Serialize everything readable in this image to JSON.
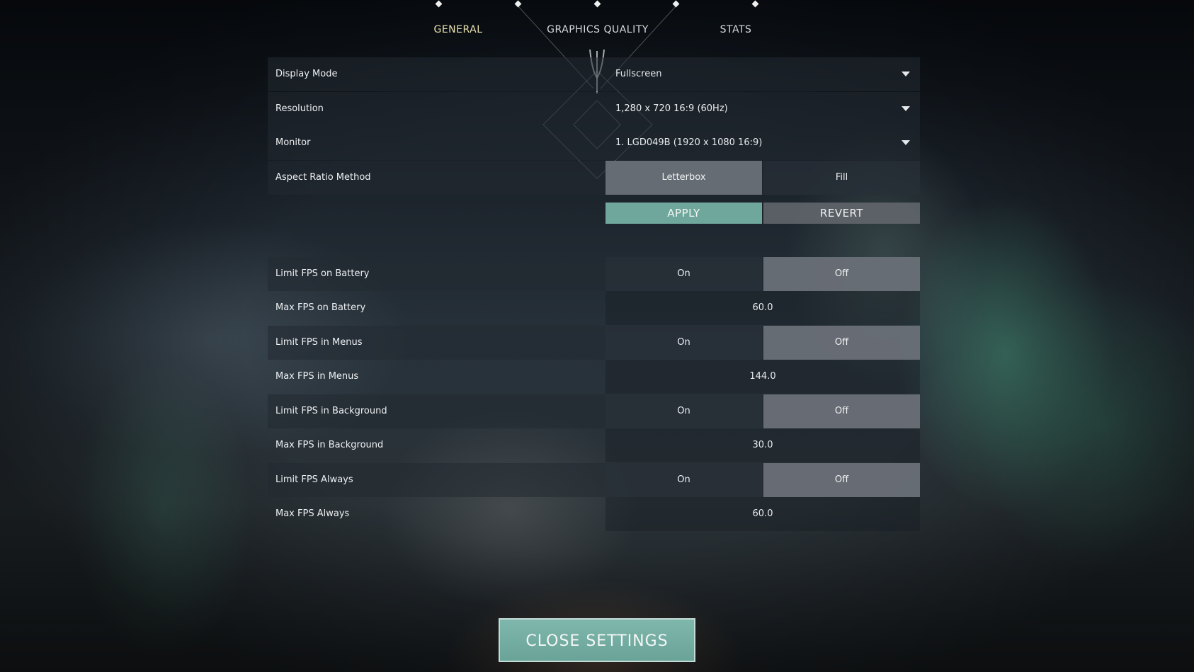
{
  "tabs": [
    {
      "label": "GENERAL",
      "active": true
    },
    {
      "label": "GRAPHICS QUALITY",
      "active": false
    },
    {
      "label": "STATS",
      "active": false
    }
  ],
  "display": {
    "display_mode": {
      "label": "Display Mode",
      "value": "Fullscreen"
    },
    "resolution": {
      "label": "Resolution",
      "value": "1,280 x 720 16:9 (60Hz)"
    },
    "monitor": {
      "label": "Monitor",
      "value": "1. LGD049B (1920 x  1080 16:9)"
    },
    "aspect_ratio": {
      "label": "Aspect Ratio Method",
      "options": [
        "Letterbox",
        "Fill"
      ],
      "selected": "Letterbox"
    }
  },
  "actions": {
    "apply": "APPLY",
    "revert": "REVERT"
  },
  "fps": [
    {
      "type": "toggle",
      "label": "Limit FPS on Battery",
      "options": [
        "On",
        "Off"
      ],
      "selected": "Off"
    },
    {
      "type": "number",
      "label": "Max FPS on Battery",
      "value": "60.0"
    },
    {
      "type": "toggle",
      "label": "Limit FPS in Menus",
      "options": [
        "On",
        "Off"
      ],
      "selected": "Off"
    },
    {
      "type": "number",
      "label": "Max FPS in Menus",
      "value": "144.0"
    },
    {
      "type": "toggle",
      "label": "Limit FPS in Background",
      "options": [
        "On",
        "Off"
      ],
      "selected": "Off"
    },
    {
      "type": "number",
      "label": "Max FPS in Background",
      "value": "30.0"
    },
    {
      "type": "toggle",
      "label": "Limit FPS Always",
      "options": [
        "On",
        "Off"
      ],
      "selected": "Off"
    },
    {
      "type": "number",
      "label": "Max FPS Always",
      "value": "60.0"
    }
  ],
  "footer": {
    "close_label": "CLOSE SETTINGS"
  },
  "colors": {
    "accent": "#6fa79c",
    "active_tab": "#e9e1b0",
    "selected_segment": "#6c727a"
  }
}
